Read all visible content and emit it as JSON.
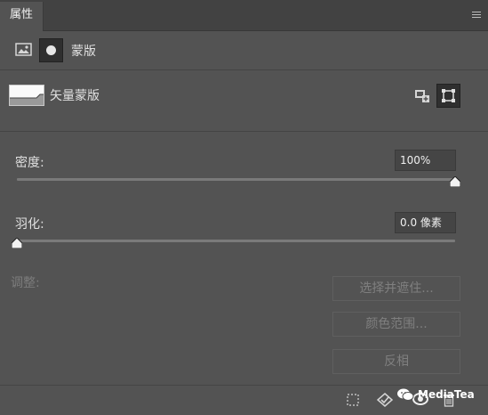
{
  "panel": {
    "title": "属性"
  },
  "mode": {
    "title": "蒙版"
  },
  "mask": {
    "label": "矢量蒙版"
  },
  "density": {
    "label": "密度:",
    "value": "100%",
    "level_percent": 100
  },
  "feather": {
    "label": "羽化:",
    "value": "0.0 像素",
    "level_percent": 0
  },
  "adjust": {
    "label": "调整:",
    "select_mask_button": "选择并遮住...",
    "color_range_button": "颜色范围...",
    "invert_button": "反相"
  },
  "watermark": {
    "text": "MediaTea"
  },
  "icons": {
    "menu": "panel-menu-icon",
    "pixel_mask": "pixel-mask-icon",
    "vector_mask": "vector-mask-icon",
    "select_from_mask": "load-selection-icon",
    "apply_mask": "apply-mask-icon",
    "disable_mask": "toggle-visibility-icon",
    "delete_mask": "trash-icon"
  },
  "colors": {
    "panel_bg": "#535353",
    "header_bg": "#424242",
    "text": "#e0e0e0",
    "disabled_text": "#7f7f7f"
  }
}
